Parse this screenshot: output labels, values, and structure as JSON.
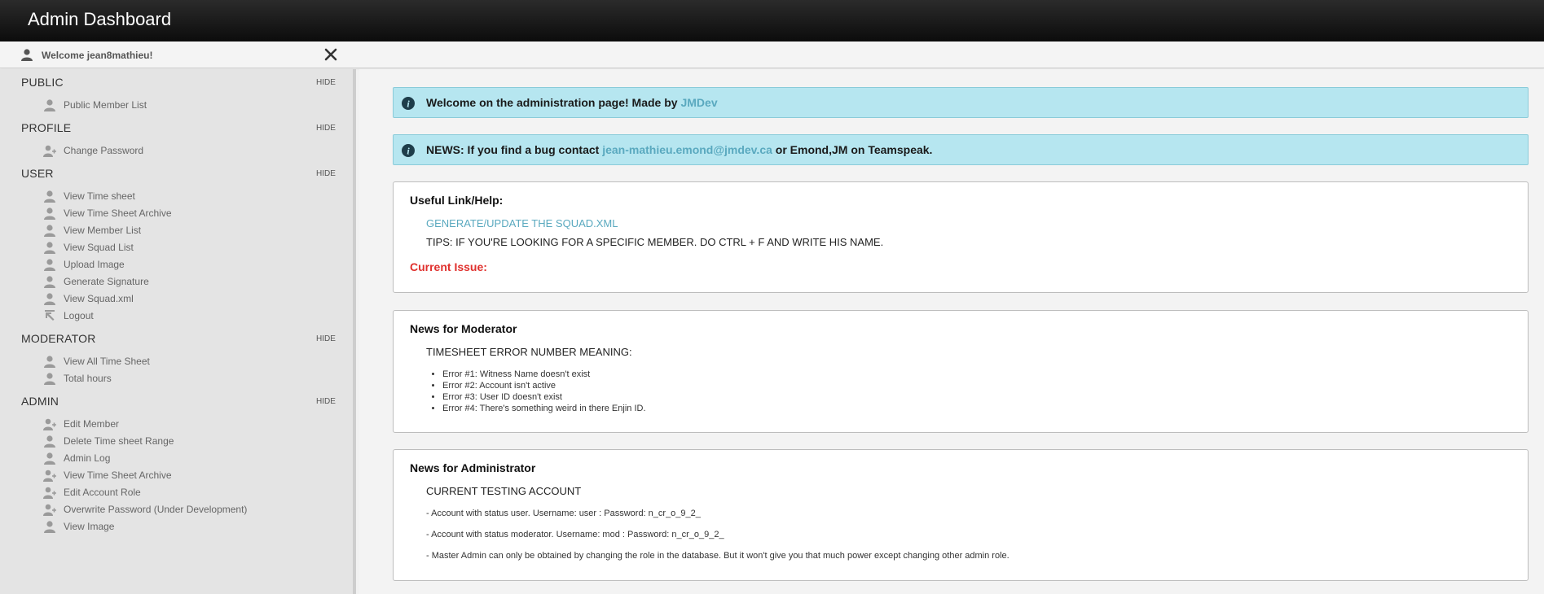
{
  "header": {
    "title": "Admin Dashboard"
  },
  "userbar": {
    "welcome": "Welcome jean8mathieu!"
  },
  "sidebar": {
    "hide_label": "HIDE",
    "sections": [
      {
        "title": "PUBLIC",
        "items": [
          {
            "label": "Public Member List",
            "icon": "user-icon"
          }
        ]
      },
      {
        "title": "PROFILE",
        "items": [
          {
            "label": "Change Password",
            "icon": "user-edit-icon"
          }
        ]
      },
      {
        "title": "USER",
        "items": [
          {
            "label": "View Time sheet",
            "icon": "user-icon"
          },
          {
            "label": "View Time Sheet Archive",
            "icon": "user-icon"
          },
          {
            "label": "View Member List",
            "icon": "user-icon"
          },
          {
            "label": "View Squad List",
            "icon": "user-icon"
          },
          {
            "label": "Upload Image",
            "icon": "user-icon"
          },
          {
            "label": "Generate Signature",
            "icon": "user-icon"
          },
          {
            "label": "View Squad.xml",
            "icon": "user-icon"
          },
          {
            "label": "Logout",
            "icon": "logout-icon"
          }
        ]
      },
      {
        "title": "MODERATOR",
        "items": [
          {
            "label": "View All Time Sheet",
            "icon": "user-icon"
          },
          {
            "label": "Total hours",
            "icon": "user-icon"
          }
        ]
      },
      {
        "title": "ADMIN",
        "items": [
          {
            "label": "Edit Member",
            "icon": "user-edit-icon"
          },
          {
            "label": "Delete Time sheet Range",
            "icon": "user-icon"
          },
          {
            "label": "Admin Log",
            "icon": "user-icon"
          },
          {
            "label": "View Time Sheet Archive",
            "icon": "user-edit-icon"
          },
          {
            "label": "Edit Account Role",
            "icon": "user-edit-icon"
          },
          {
            "label": "Overwrite Password (Under Development)",
            "icon": "user-edit-icon"
          },
          {
            "label": "View Image",
            "icon": "user-icon"
          }
        ]
      }
    ]
  },
  "alerts": {
    "welcome": {
      "text": "Welcome on the administration page! Made by ",
      "link": "JMDev"
    },
    "news": {
      "prefix": "NEWS: If you find a bug contact ",
      "email": "jean-mathieu.emond@jmdev.ca",
      "suffix": " or Emond,JM on Teamspeak."
    }
  },
  "useful": {
    "title": "Useful Link/Help:",
    "link": "GENERATE/UPDATE THE SQUAD.XML",
    "tips": "TIPS: IF YOU'RE LOOKING FOR A SPECIFIC MEMBER. DO CTRL + F AND WRITE HIS NAME.",
    "issue": "Current Issue:"
  },
  "moderator": {
    "title": "News for Moderator",
    "subtitle": "TIMESHEET ERROR NUMBER MEANING:",
    "errors": [
      "Error #1: Witness Name doesn't exist",
      "Error #2: Account isn't active",
      "Error #3: User ID doesn't exist",
      "Error #4: There's something weird in there Enjin ID."
    ]
  },
  "administrator": {
    "title": "News for Administrator",
    "subtitle": "CURRENT TESTING ACCOUNT",
    "lines": [
      "- Account with status user. Username: user : Password: n_cr_o_9_2_",
      "- Account with status moderator. Username: mod : Password: n_cr_o_9_2_",
      "- Master Admin can only be obtained by changing the role in the database. But it won't give you that much power except changing other admin role."
    ]
  }
}
